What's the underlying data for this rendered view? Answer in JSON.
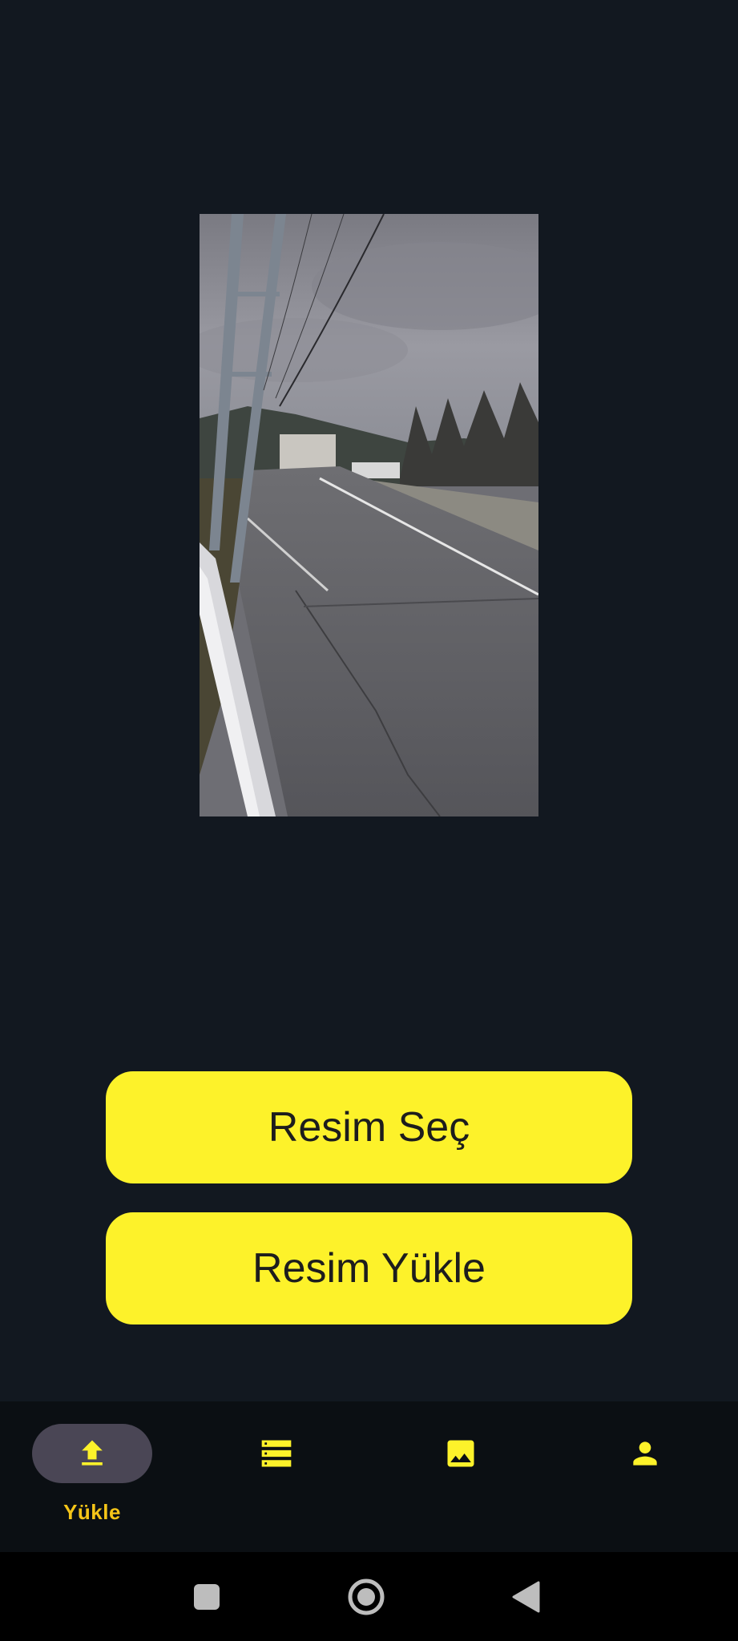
{
  "actions": {
    "select_label": "Resim Seç",
    "upload_label": "Resim Yükle"
  },
  "nav": {
    "items": [
      {
        "icon": "upload-icon",
        "label": "Yükle",
        "active": true
      },
      {
        "icon": "list-icon",
        "label": "",
        "active": false
      },
      {
        "icon": "image-icon",
        "label": "",
        "active": false
      },
      {
        "icon": "person-icon",
        "label": "",
        "active": false
      }
    ]
  },
  "system_nav": {
    "icons": [
      "recents-icon",
      "home-icon",
      "back-icon"
    ]
  },
  "colors": {
    "background": "#121820",
    "accent_yellow": "#fdf22a",
    "nav_label": "#f5c518",
    "nav_bar": "#0b0f13",
    "active_pill": "#4a4655"
  }
}
